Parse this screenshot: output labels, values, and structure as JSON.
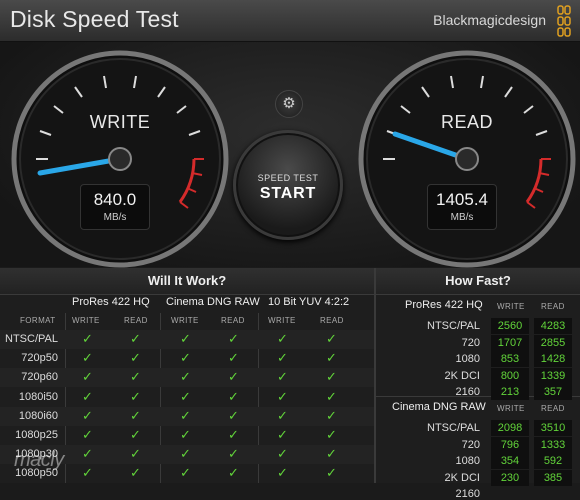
{
  "app": {
    "title": "Disk Speed Test",
    "brand": "Blackmagicdesign"
  },
  "write_gauge": {
    "label": "WRITE",
    "value": "840.0",
    "unit": "MB/s"
  },
  "read_gauge": {
    "label": "READ",
    "value": "1405.4",
    "unit": "MB/s"
  },
  "start_button": {
    "top": "SPEED TEST",
    "main": "START"
  },
  "will_it_work": {
    "title": "Will It Work?",
    "format_header": "FORMAT",
    "columns": [
      {
        "name": "ProRes 422 HQ",
        "write": "WRITE",
        "read": "READ"
      },
      {
        "name": "Cinema DNG RAW",
        "write": "WRITE",
        "read": "READ"
      },
      {
        "name": "10 Bit YUV 4:2:2",
        "write": "WRITE",
        "read": "READ"
      }
    ],
    "rows": [
      "NTSC/PAL",
      "720p50",
      "720p60",
      "1080i50",
      "1080i60",
      "1080p25",
      "1080p30",
      "1080p50"
    ],
    "check": "✓"
  },
  "how_fast": {
    "title": "How Fast?",
    "groups": [
      {
        "name": "ProRes 422 HQ",
        "write": "WRITE",
        "read": "READ",
        "rows": [
          {
            "label": "NTSC/PAL",
            "write": "2560",
            "read": "4283"
          },
          {
            "label": "720",
            "write": "1707",
            "read": "2855"
          },
          {
            "label": "1080",
            "write": "853",
            "read": "1428"
          },
          {
            "label": "2K DCI",
            "write": "800",
            "read": "1339"
          },
          {
            "label": "2160",
            "write": "213",
            "read": "357"
          }
        ]
      },
      {
        "name": "Cinema DNG RAW",
        "write": "WRITE",
        "read": "READ",
        "rows": [
          {
            "label": "NTSC/PAL",
            "write": "2098",
            "read": "3510"
          },
          {
            "label": "720",
            "write": "796",
            "read": "1333"
          },
          {
            "label": "1080",
            "write": "354",
            "read": "592"
          },
          {
            "label": "2K DCI",
            "write": "230",
            "read": "385"
          },
          {
            "label": "2160",
            "write": "",
            "read": ""
          }
        ]
      }
    ]
  },
  "watermark": "macly",
  "icons": {
    "settings": "gear-icon",
    "logo": "blackmagic-logo-icon"
  },
  "colors": {
    "accent_needle": "#2aa7e8",
    "check_green": "#62d43a",
    "redline": "#d42b2b"
  }
}
